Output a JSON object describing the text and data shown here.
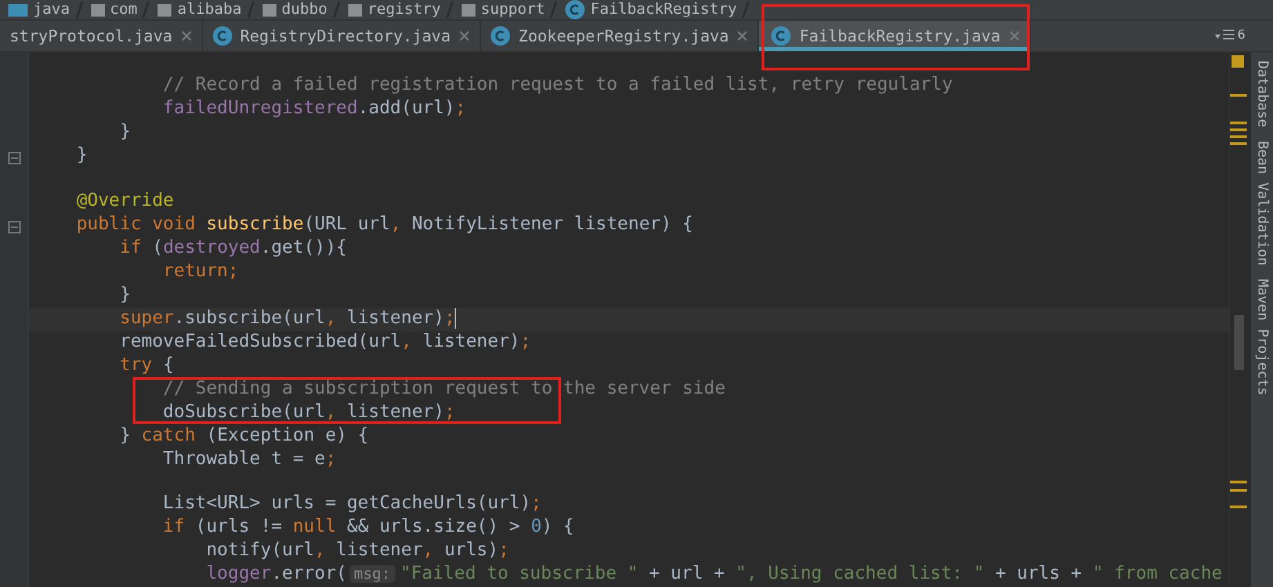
{
  "breadcrumb": [
    {
      "label": "java",
      "kind": "source"
    },
    {
      "label": "com",
      "kind": "package"
    },
    {
      "label": "alibaba",
      "kind": "package"
    },
    {
      "label": "dubbo",
      "kind": "package"
    },
    {
      "label": "registry",
      "kind": "package"
    },
    {
      "label": "support",
      "kind": "package"
    },
    {
      "label": "FailbackRegistry",
      "kind": "class"
    }
  ],
  "tabs": [
    {
      "label": "stryProtocol.java",
      "icon": false,
      "selected": false
    },
    {
      "label": "RegistryDirectory.java",
      "icon": true,
      "selected": false
    },
    {
      "label": "ZookeeperRegistry.java",
      "icon": true,
      "selected": false
    },
    {
      "label": "FailbackRegistry.java",
      "icon": true,
      "selected": true
    }
  ],
  "tab_count": "6",
  "code": [
    {
      "fold": false,
      "current": false
    },
    {
      "fold": false,
      "current": false,
      "tokens": [
        {
          "t": "            // Record a failed registration request to a failed list, retry regularly",
          "kind": "comment"
        }
      ]
    },
    {
      "fold": false,
      "current": false,
      "tokens": [
        {
          "t": "            failedUnregistered",
          "kind": "field"
        },
        {
          "t": ".add(url)",
          "kind": "plain"
        },
        {
          "t": ";",
          "kind": "keyword"
        }
      ]
    },
    {
      "fold": false,
      "current": false,
      "tokens": [
        {
          "t": "        }",
          "kind": "plain"
        }
      ]
    },
    {
      "fold": true,
      "current": false,
      "tokens": [
        {
          "t": "    }",
          "kind": "plain"
        }
      ]
    },
    {
      "fold": false,
      "current": false
    },
    {
      "fold": false,
      "current": false,
      "tokens": [
        {
          "t": "    @Override",
          "kind": "annotation"
        }
      ]
    },
    {
      "fold": true,
      "current": false,
      "tokens": [
        {
          "t": "    public void ",
          "kind": "keyword"
        },
        {
          "t": "subscribe",
          "kind": "decl"
        },
        {
          "t": "(URL url",
          "kind": "plain"
        },
        {
          "t": ", ",
          "kind": "keyword"
        },
        {
          "t": "NotifyListener listener) {",
          "kind": "plain"
        }
      ]
    },
    {
      "fold": false,
      "current": false,
      "tokens": [
        {
          "t": "        if ",
          "kind": "keyword"
        },
        {
          "t": "(",
          "kind": "plain"
        },
        {
          "t": "destroyed",
          "kind": "field"
        },
        {
          "t": ".get()){",
          "kind": "plain"
        }
      ]
    },
    {
      "fold": false,
      "current": false,
      "tokens": [
        {
          "t": "            return;",
          "kind": "keyword"
        }
      ]
    },
    {
      "fold": false,
      "current": false,
      "tokens": [
        {
          "t": "        }",
          "kind": "plain"
        }
      ]
    },
    {
      "fold": false,
      "current": true,
      "tokens": [
        {
          "t": "        super",
          "kind": "keyword"
        },
        {
          "t": ".subscribe(url",
          "kind": "plain"
        },
        {
          "t": ", ",
          "kind": "keyword"
        },
        {
          "t": "listener)",
          "kind": "plain"
        },
        {
          "t": ";",
          "kind": "keyword"
        }
      ]
    },
    {
      "fold": false,
      "current": false,
      "tokens": [
        {
          "t": "        removeFailedSubscribed(url",
          "kind": "plain"
        },
        {
          "t": ", ",
          "kind": "keyword"
        },
        {
          "t": "listener)",
          "kind": "plain"
        },
        {
          "t": ";",
          "kind": "keyword"
        }
      ]
    },
    {
      "fold": false,
      "current": false,
      "tokens": [
        {
          "t": "        try ",
          "kind": "keyword"
        },
        {
          "t": "{",
          "kind": "plain"
        }
      ]
    },
    {
      "fold": false,
      "current": false,
      "tokens": [
        {
          "t": "            // Sending a subscription request to the server side",
          "kind": "comment"
        }
      ]
    },
    {
      "fold": false,
      "current": false,
      "tokens": [
        {
          "t": "            doSubscribe(url",
          "kind": "plain"
        },
        {
          "t": ", ",
          "kind": "keyword"
        },
        {
          "t": "listener)",
          "kind": "plain"
        },
        {
          "t": ";",
          "kind": "keyword"
        }
      ]
    },
    {
      "fold": false,
      "current": false,
      "tokens": [
        {
          "t": "        } ",
          "kind": "plain"
        },
        {
          "t": "catch ",
          "kind": "keyword"
        },
        {
          "t": "(Exception e) {",
          "kind": "plain"
        }
      ]
    },
    {
      "fold": false,
      "current": false,
      "tokens": [
        {
          "t": "            Throwable t = e",
          "kind": "plain"
        },
        {
          "t": ";",
          "kind": "keyword"
        }
      ]
    },
    {
      "fold": false,
      "current": false
    },
    {
      "fold": false,
      "current": false,
      "tokens": [
        {
          "t": "            List<URL> urls = getCacheUrls(url)",
          "kind": "plain"
        },
        {
          "t": ";",
          "kind": "keyword"
        }
      ]
    },
    {
      "fold": false,
      "current": false,
      "tokens": [
        {
          "t": "            if ",
          "kind": "keyword"
        },
        {
          "t": "(urls != ",
          "kind": "plain"
        },
        {
          "t": "null ",
          "kind": "keyword"
        },
        {
          "t": "&& urls.size() > ",
          "kind": "plain"
        },
        {
          "t": "0",
          "kind": "number"
        },
        {
          "t": ") {",
          "kind": "plain"
        }
      ]
    },
    {
      "fold": false,
      "current": false,
      "tokens": [
        {
          "t": "                notify(url",
          "kind": "plain"
        },
        {
          "t": ", ",
          "kind": "keyword"
        },
        {
          "t": "listener",
          "kind": "plain"
        },
        {
          "t": ", ",
          "kind": "keyword"
        },
        {
          "t": "urls)",
          "kind": "plain"
        },
        {
          "t": ";",
          "kind": "keyword"
        }
      ]
    },
    {
      "fold": false,
      "current": false,
      "tokens": [
        {
          "t": "                logger",
          "kind": "field"
        },
        {
          "t": ".error(",
          "kind": "plain"
        },
        {
          "t": "msg:",
          "kind": "hint"
        },
        {
          "t": "\"Failed to subscribe \" ",
          "kind": "string"
        },
        {
          "t": "+ url + ",
          "kind": "plain"
        },
        {
          "t": "\", Using cached list: \" ",
          "kind": "string"
        },
        {
          "t": "+ urls + ",
          "kind": "plain"
        },
        {
          "t": "\" from cache",
          "kind": "string"
        }
      ]
    }
  ],
  "tool_windows": [
    "Database",
    "Bean Validation",
    "Maven Projects"
  ]
}
